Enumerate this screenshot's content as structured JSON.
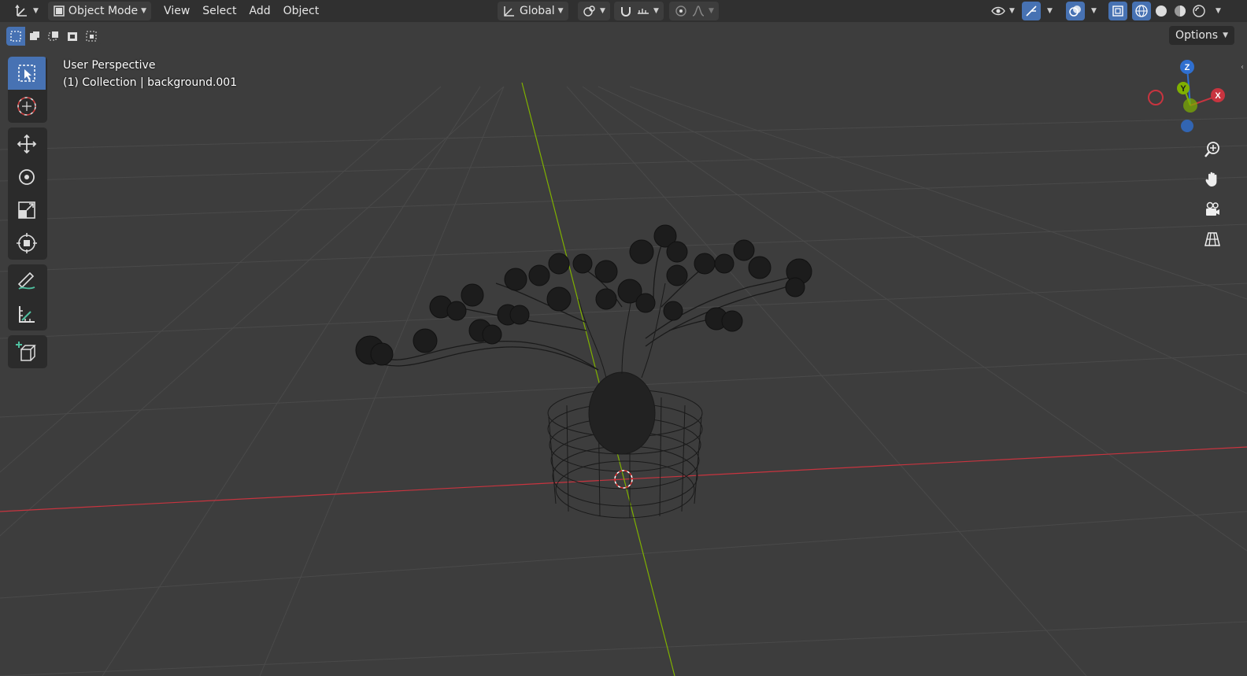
{
  "header": {
    "mode_label": "Object Mode",
    "menus": [
      "View",
      "Select",
      "Add",
      "Object"
    ],
    "orientation_label": "Global"
  },
  "options_label": "Options",
  "overlay": {
    "view_name": "User Perspective",
    "collection_info": "(1) Collection | background.001"
  },
  "gizmo": {
    "z_label": "Z",
    "y_label": "Y",
    "x_label": "X"
  },
  "colors": {
    "accent": "#4772b3",
    "x_axis": "#c8343f",
    "y_axis": "#7fb000",
    "z_axis": "#2f6fcf",
    "background": "#3d3d3d"
  },
  "icons": {
    "editor_type": "axis-icon",
    "tools": [
      "select-box-icon",
      "cursor-icon",
      "move-icon",
      "rotate-icon",
      "scale-icon",
      "transform-icon",
      "annotate-icon",
      "measure-icon",
      "add-cube-icon"
    ],
    "nav": [
      "zoom-icon",
      "pan-hand-icon",
      "camera-icon",
      "perspective-grid-icon"
    ]
  }
}
